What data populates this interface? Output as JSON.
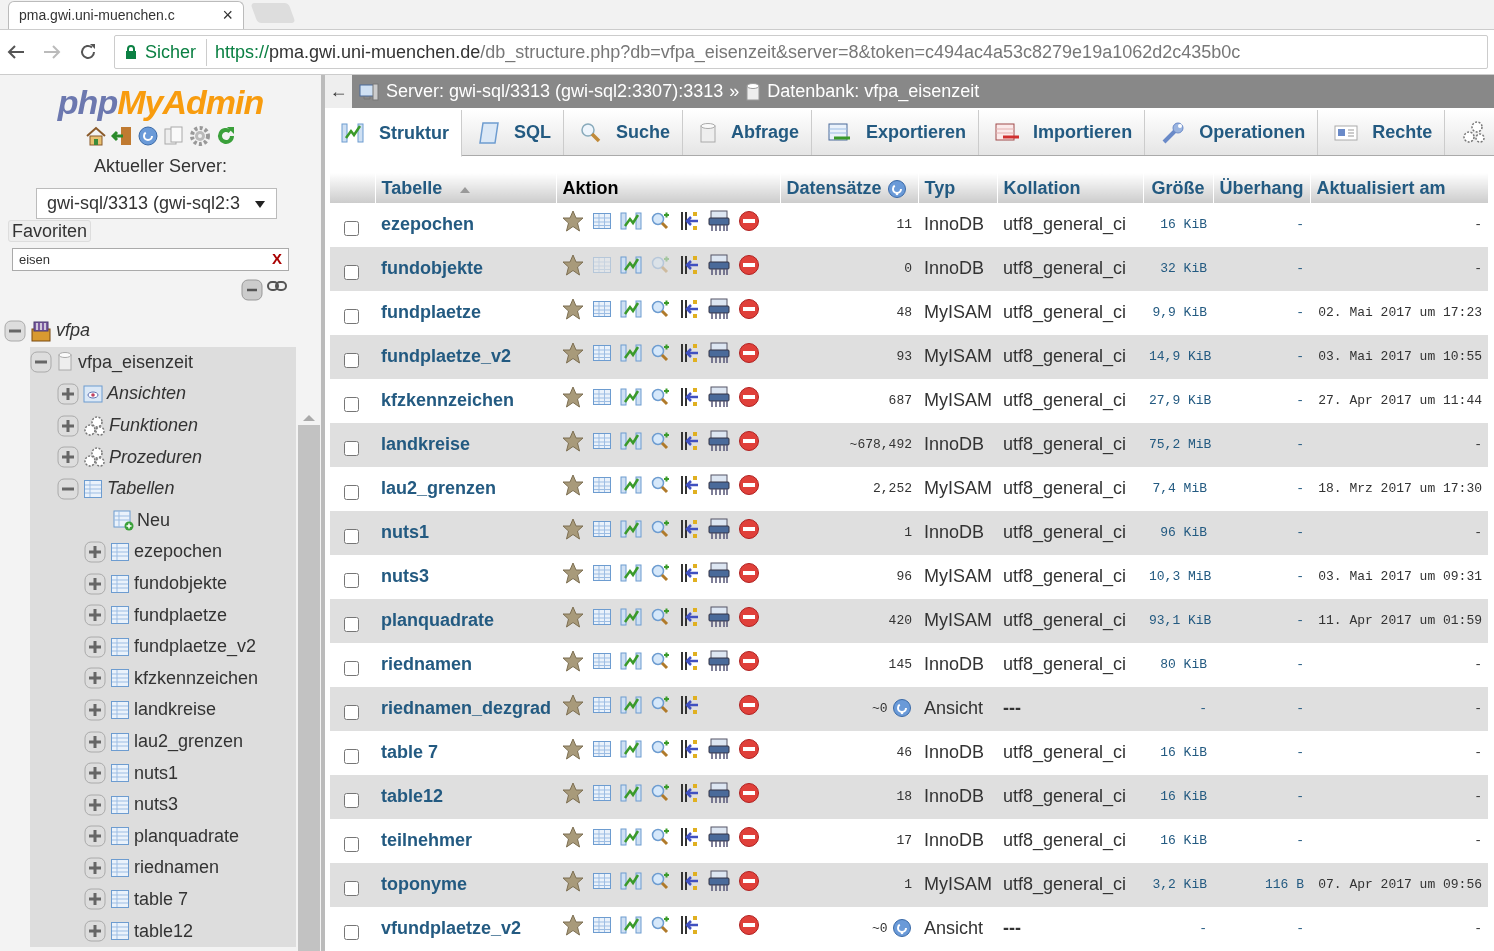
{
  "browser": {
    "tab_title": "pma.gwi.uni-muenchen.c",
    "tab_close": "×",
    "security": "Sicher",
    "url_scheme": "https://",
    "url_host": "pma.gwi.uni-muenchen.de",
    "url_path": "/db_structure.php?db=vfpa_eisenzeit&server=8&token=c494ac4a53c8279e19a1062d2c435b0c"
  },
  "sidebar": {
    "logo_php": "php",
    "logo_myadmin": "MyAdmin",
    "server_label": "Aktueller Server:",
    "server_select": "gwi-sql/3313 (gwi-sql2:3",
    "favorites": "Favoriten",
    "filter": {
      "value": "eisen",
      "clear": "X"
    },
    "tree": [
      {
        "label": "vfpa",
        "kind": "server-db",
        "expanded": true,
        "children": [
          {
            "label": "vfpa_eisenzeit",
            "kind": "database",
            "expanded": true,
            "children": [
              {
                "label": "Ansichten",
                "kind": "views",
                "expanded": false
              },
              {
                "label": "Funktionen",
                "kind": "routines",
                "expanded": false
              },
              {
                "label": "Prozeduren",
                "kind": "routines",
                "expanded": false
              },
              {
                "label": "Tabellen",
                "kind": "tables",
                "expanded": true,
                "children": [
                  {
                    "label": "Neu",
                    "kind": "new"
                  },
                  {
                    "label": "ezepochen",
                    "kind": "table",
                    "expanded": false
                  },
                  {
                    "label": "fundobjekte",
                    "kind": "table",
                    "expanded": false
                  },
                  {
                    "label": "fundplaetze",
                    "kind": "table",
                    "expanded": false
                  },
                  {
                    "label": "fundplaetze_v2",
                    "kind": "table",
                    "expanded": false
                  },
                  {
                    "label": "kfzkennzeichen",
                    "kind": "table",
                    "expanded": false
                  },
                  {
                    "label": "landkreise",
                    "kind": "table",
                    "expanded": false
                  },
                  {
                    "label": "lau2_grenzen",
                    "kind": "table",
                    "expanded": false
                  },
                  {
                    "label": "nuts1",
                    "kind": "table",
                    "expanded": false
                  },
                  {
                    "label": "nuts3",
                    "kind": "table",
                    "expanded": false
                  },
                  {
                    "label": "planquadrate",
                    "kind": "table",
                    "expanded": false
                  },
                  {
                    "label": "riednamen",
                    "kind": "table",
                    "expanded": false
                  },
                  {
                    "label": "table 7",
                    "kind": "table",
                    "expanded": false
                  },
                  {
                    "label": "table12",
                    "kind": "table",
                    "expanded": false
                  }
                ]
              }
            ]
          }
        ]
      }
    ]
  },
  "breadcrumb": {
    "back": "←",
    "server": "Server: gwi-sql/3313 (gwi-sql2:3307):3313",
    "separator": "»",
    "database": "Datenbank: vfpa_eisenzeit"
  },
  "tabs": [
    {
      "label": "Struktur",
      "kind": "structure",
      "selected": true
    },
    {
      "label": "SQL",
      "kind": "sql",
      "selected": false
    },
    {
      "label": "Suche",
      "kind": "search",
      "selected": false
    },
    {
      "label": "Abfrage",
      "kind": "query",
      "selected": false
    },
    {
      "label": "Exportieren",
      "kind": "export",
      "selected": false
    },
    {
      "label": "Importieren",
      "kind": "import",
      "selected": false
    },
    {
      "label": "Operationen",
      "kind": "operations",
      "selected": false
    },
    {
      "label": "Rechte",
      "kind": "privileges",
      "selected": false
    },
    {
      "kind": "routines",
      "selected": false
    }
  ],
  "table": {
    "columns": [
      {
        "label": "Tabelle",
        "sorted": true
      },
      {
        "label": "Aktion",
        "sorted": false
      },
      {
        "label": "Datensätze",
        "sorted": false
      },
      {
        "label": "Typ",
        "sorted": false
      },
      {
        "label": "Kollation",
        "sorted": false
      },
      {
        "label": "Größe",
        "sorted": false
      },
      {
        "label": "Überhang",
        "sorted": false
      },
      {
        "label": "Aktualisiert am",
        "sorted": false
      }
    ],
    "rows": [
      {
        "name": "ezepochen",
        "kind": "table",
        "empty": false,
        "checked": false,
        "rows": "11",
        "type": "InnoDB",
        "collation": "utf8_general_ci",
        "size": "16 KiB",
        "overhead": "-",
        "updated": "-"
      },
      {
        "name": "fundobjekte",
        "kind": "table",
        "empty": true,
        "checked": false,
        "rows": "0",
        "type": "InnoDB",
        "collation": "utf8_general_ci",
        "size": "32 KiB",
        "overhead": "-",
        "updated": "-"
      },
      {
        "name": "fundplaetze",
        "kind": "table",
        "empty": false,
        "checked": false,
        "rows": "48",
        "type": "MyISAM",
        "collation": "utf8_general_ci",
        "size": "9,9 KiB",
        "overhead": "-",
        "updated": "02. Mai 2017 um 17:23"
      },
      {
        "name": "fundplaetze_v2",
        "kind": "table",
        "empty": false,
        "checked": false,
        "rows": "93",
        "type": "MyISAM",
        "collation": "utf8_general_ci",
        "size": "14,9 KiB",
        "overhead": "-",
        "updated": "03. Mai 2017 um 10:55"
      },
      {
        "name": "kfzkennzeichen",
        "kind": "table",
        "empty": false,
        "checked": false,
        "rows": "687",
        "type": "MyISAM",
        "collation": "utf8_general_ci",
        "size": "27,9 KiB",
        "overhead": "-",
        "updated": "27. Apr 2017 um 11:44"
      },
      {
        "name": "landkreise",
        "kind": "table",
        "empty": false,
        "checked": false,
        "rows": "~678,492",
        "type": "InnoDB",
        "collation": "utf8_general_ci",
        "size": "75,2 MiB",
        "overhead": "-",
        "updated": "-"
      },
      {
        "name": "lau2_grenzen",
        "kind": "table",
        "empty": false,
        "checked": false,
        "rows": "2,252",
        "type": "MyISAM",
        "collation": "utf8_general_ci",
        "size": "7,4 MiB",
        "overhead": "-",
        "updated": "18. Mrz 2017 um 17:30"
      },
      {
        "name": "nuts1",
        "kind": "table",
        "empty": false,
        "checked": false,
        "rows": "1",
        "type": "InnoDB",
        "collation": "utf8_general_ci",
        "size": "96 KiB",
        "overhead": "-",
        "updated": "-"
      },
      {
        "name": "nuts3",
        "kind": "table",
        "empty": false,
        "checked": false,
        "rows": "96",
        "type": "MyISAM",
        "collation": "utf8_general_ci",
        "size": "10,3 MiB",
        "overhead": "-",
        "updated": "03. Mai 2017 um 09:31"
      },
      {
        "name": "planquadrate",
        "kind": "table",
        "empty": false,
        "checked": false,
        "rows": "420",
        "type": "MyISAM",
        "collation": "utf8_general_ci",
        "size": "93,1 KiB",
        "overhead": "-",
        "updated": "11. Apr 2017 um 01:59"
      },
      {
        "name": "riednamen",
        "kind": "table",
        "empty": false,
        "checked": false,
        "rows": "145",
        "type": "InnoDB",
        "collation": "utf8_general_ci",
        "size": "80 KiB",
        "overhead": "-",
        "updated": "-"
      },
      {
        "name": "riednamen_dezgrad",
        "kind": "view",
        "empty": false,
        "checked": false,
        "rows": "~0",
        "type": "Ansicht",
        "collation": "---",
        "size": "-",
        "overhead": "-",
        "updated": "-"
      },
      {
        "name": "table 7",
        "kind": "table",
        "empty": false,
        "checked": false,
        "rows": "46",
        "type": "InnoDB",
        "collation": "utf8_general_ci",
        "size": "16 KiB",
        "overhead": "-",
        "updated": "-"
      },
      {
        "name": "table12",
        "kind": "table",
        "empty": false,
        "checked": false,
        "rows": "18",
        "type": "InnoDB",
        "collation": "utf8_general_ci",
        "size": "16 KiB",
        "overhead": "-",
        "updated": "-"
      },
      {
        "name": "teilnehmer",
        "kind": "table",
        "empty": false,
        "checked": false,
        "rows": "17",
        "type": "InnoDB",
        "collation": "utf8_general_ci",
        "size": "16 KiB",
        "overhead": "-",
        "updated": "-"
      },
      {
        "name": "toponyme",
        "kind": "table",
        "empty": false,
        "checked": false,
        "rows": "1",
        "type": "MyISAM",
        "collation": "utf8_general_ci",
        "size": "3,2 KiB",
        "overhead": "116 B",
        "updated": "07. Apr 2017 um 09:56"
      },
      {
        "name": "vfundplaetze_v2",
        "kind": "view",
        "empty": false,
        "checked": false,
        "rows": "~0",
        "type": "Ansicht",
        "collation": "---",
        "size": "-",
        "overhead": "-",
        "updated": "-"
      }
    ]
  }
}
